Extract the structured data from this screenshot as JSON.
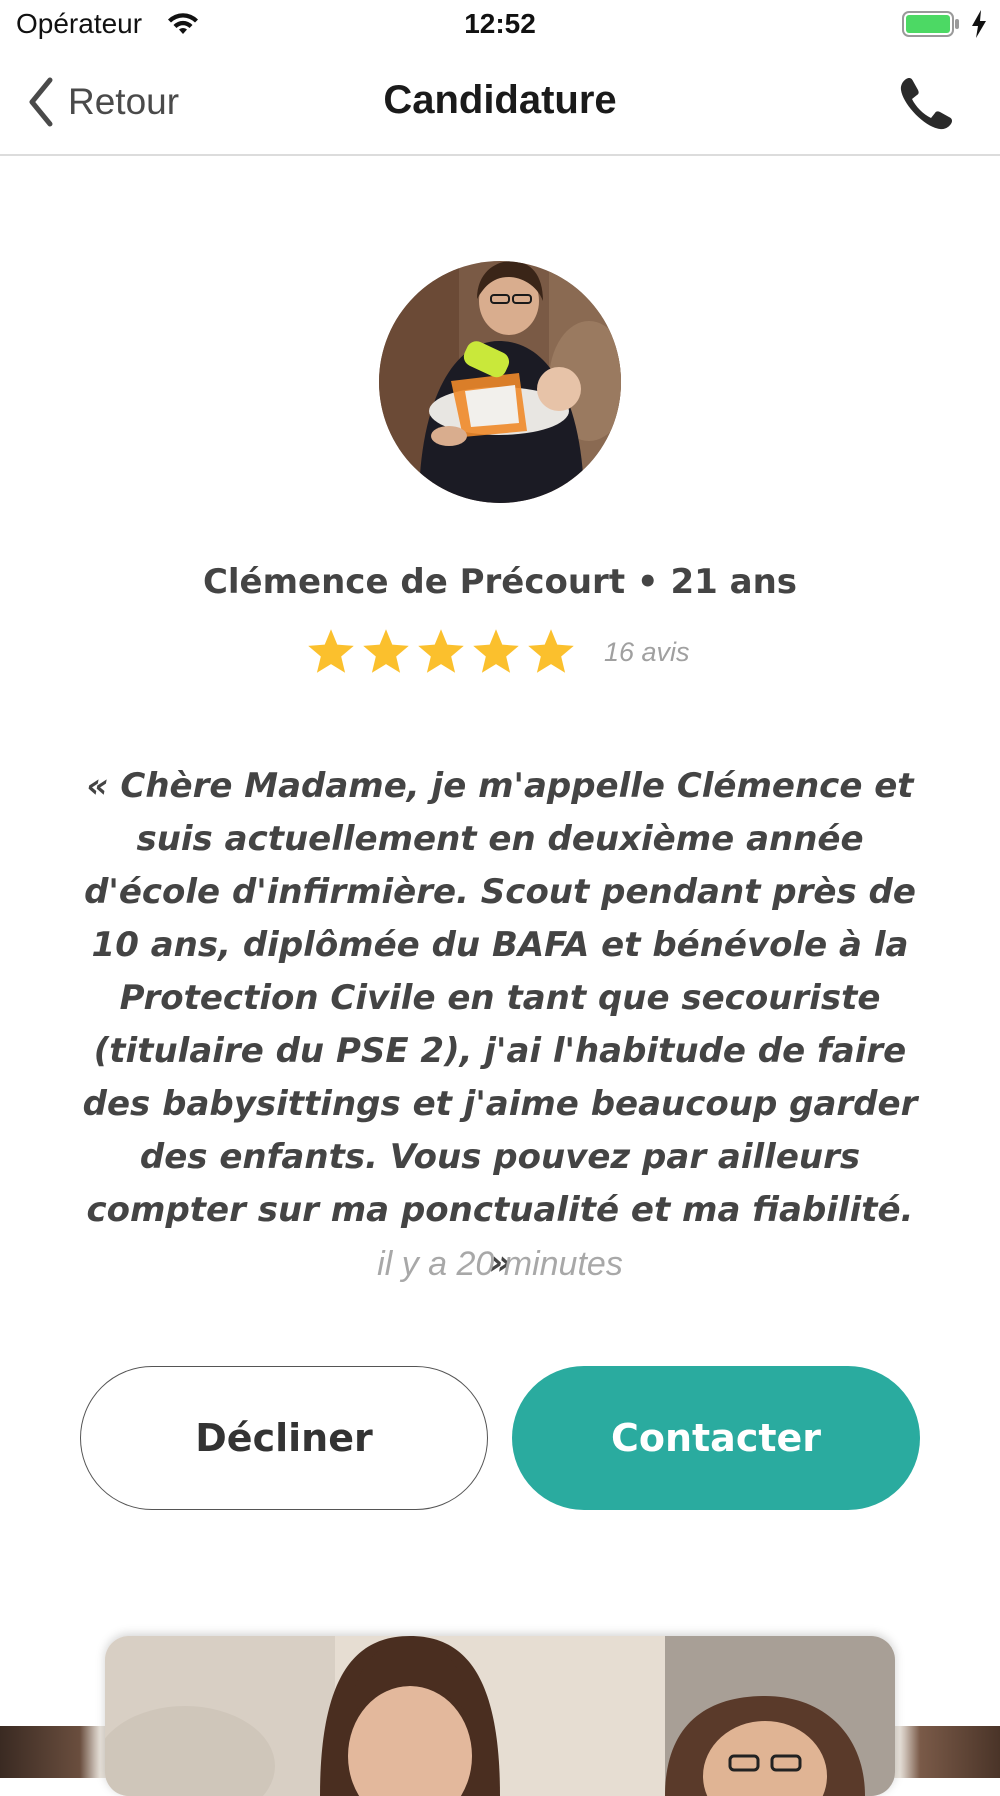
{
  "status_bar": {
    "carrier": "Opérateur",
    "time": "12:52",
    "battery_color": "#4cd964"
  },
  "nav": {
    "back_label": "Retour",
    "title": "Candidature",
    "phone_icon": "phone-icon"
  },
  "profile": {
    "name_line": "Clémence de Précourt • 21 ans",
    "rating": 5,
    "rating_max": 5,
    "star_color": "#fbc02d",
    "review_count": "16 avis"
  },
  "application": {
    "message": "« Chère Madame, je m'appelle Clémence et suis actuellement en deuxième année d'école d'infirmière. Scout pendant près de 10 ans, diplômée du BAFA et bénévole à la Protection Civile en tant que secouriste (titulaire du PSE 2), j'ai l'habitude de faire des babysittings et j'aime beaucoup garder des enfants. Vous pouvez par ailleurs compter sur ma ponctualité et ma fiabilité.  »",
    "timestamp": "il y a 20 minutes"
  },
  "actions": {
    "decline_label": "Décliner",
    "contact_label": "Contacter",
    "contact_color": "#2aab9f"
  }
}
